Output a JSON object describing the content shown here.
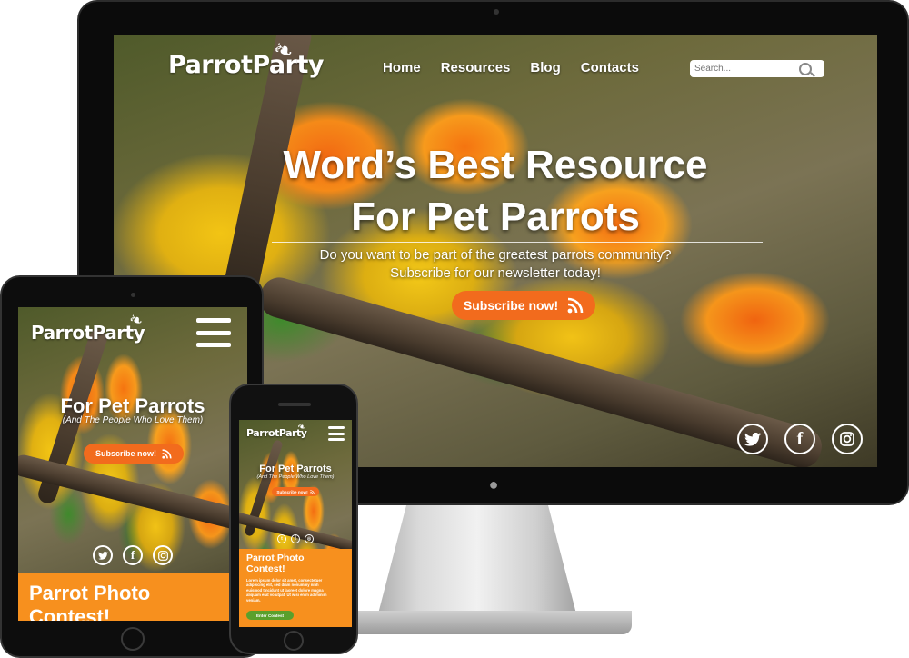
{
  "brand": {
    "name": "ParrotParty"
  },
  "nav": {
    "items": [
      "Home",
      "Resources",
      "Blog",
      "Contacts"
    ]
  },
  "search": {
    "placeholder": "Search..."
  },
  "hero": {
    "title_line1": "Word’s Best Resource",
    "title_line2": "For Pet Parrots",
    "subtitle_line1": "Do you want to be part of the greatest parrots community?",
    "subtitle_line2": "Subscribe for our newsletter today!",
    "subscribe_label": "Subscribe now!"
  },
  "tablet": {
    "title": "For Pet Parrots",
    "tagline": "(And The People Who Love Them)",
    "subscribe_label": "Subscribe now!",
    "contest_title_line1": "Parrot Photo",
    "contest_title_line2": "Contest!"
  },
  "phone": {
    "title": "For Pet Parrots",
    "tagline": "(And The People Who Love Them)",
    "subscribe_label": "Subscribe now!",
    "contest_title_line1": "Parrot Photo",
    "contest_title_line2": "Contest!",
    "contest_text": "Lorem ipsum dolor sit amet, consectetuer adipiscing elit, sed diam nonummy nibh euismod tincidunt ut laoreet dolore magna aliquam erat volutpat. Ut wisi enim ad minim veniam.",
    "enter_label": "Enter Contest"
  },
  "social": {
    "icons": [
      "twitter-icon",
      "facebook-icon",
      "instagram-icon"
    ]
  },
  "colors": {
    "accent": "#f26b1d",
    "contest_panel": "#f7901e",
    "enter_button": "#5aa02c"
  }
}
